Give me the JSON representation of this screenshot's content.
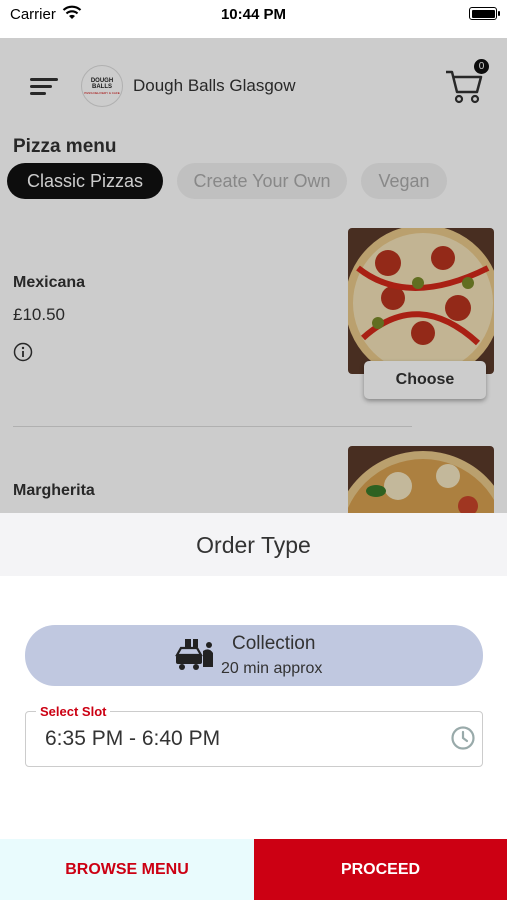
{
  "status_bar": {
    "carrier": "Carrier",
    "time": "10:44 PM"
  },
  "header": {
    "restaurant_name": "Dough Balls Glasgow",
    "logo_text_line1": "DOUGH",
    "logo_text_line2": "BALLS",
    "logo_subtext": "PIZZA DELIVERY & CAFE",
    "cart_count": "0"
  },
  "menu": {
    "title": "Pizza menu",
    "categories": [
      {
        "label": "Classic Pizzas",
        "active": true
      },
      {
        "label": "Create Your Own",
        "active": false
      },
      {
        "label": "Vegan",
        "active": false
      }
    ],
    "items": [
      {
        "name": "Mexicana",
        "price": "£10.50",
        "choose_label": "Choose"
      },
      {
        "name": "Margherita"
      }
    ]
  },
  "order_sheet": {
    "title": "Order Type",
    "option": {
      "label": "Collection",
      "time": "20 min approx"
    },
    "slot": {
      "label": "Select Slot",
      "value": "6:35 PM - 6:40 PM"
    }
  },
  "footer": {
    "browse_label": "BROWSE MENU",
    "proceed_label": "PROCEED"
  },
  "colors": {
    "accent_red": "#cc0013",
    "option_bg": "#c0c8e0",
    "active_chip": "#111111"
  },
  "icons": [
    "wifi-icon",
    "battery-icon",
    "menu-icon",
    "cart-icon",
    "info-icon",
    "collection-icon",
    "clock-icon"
  ]
}
